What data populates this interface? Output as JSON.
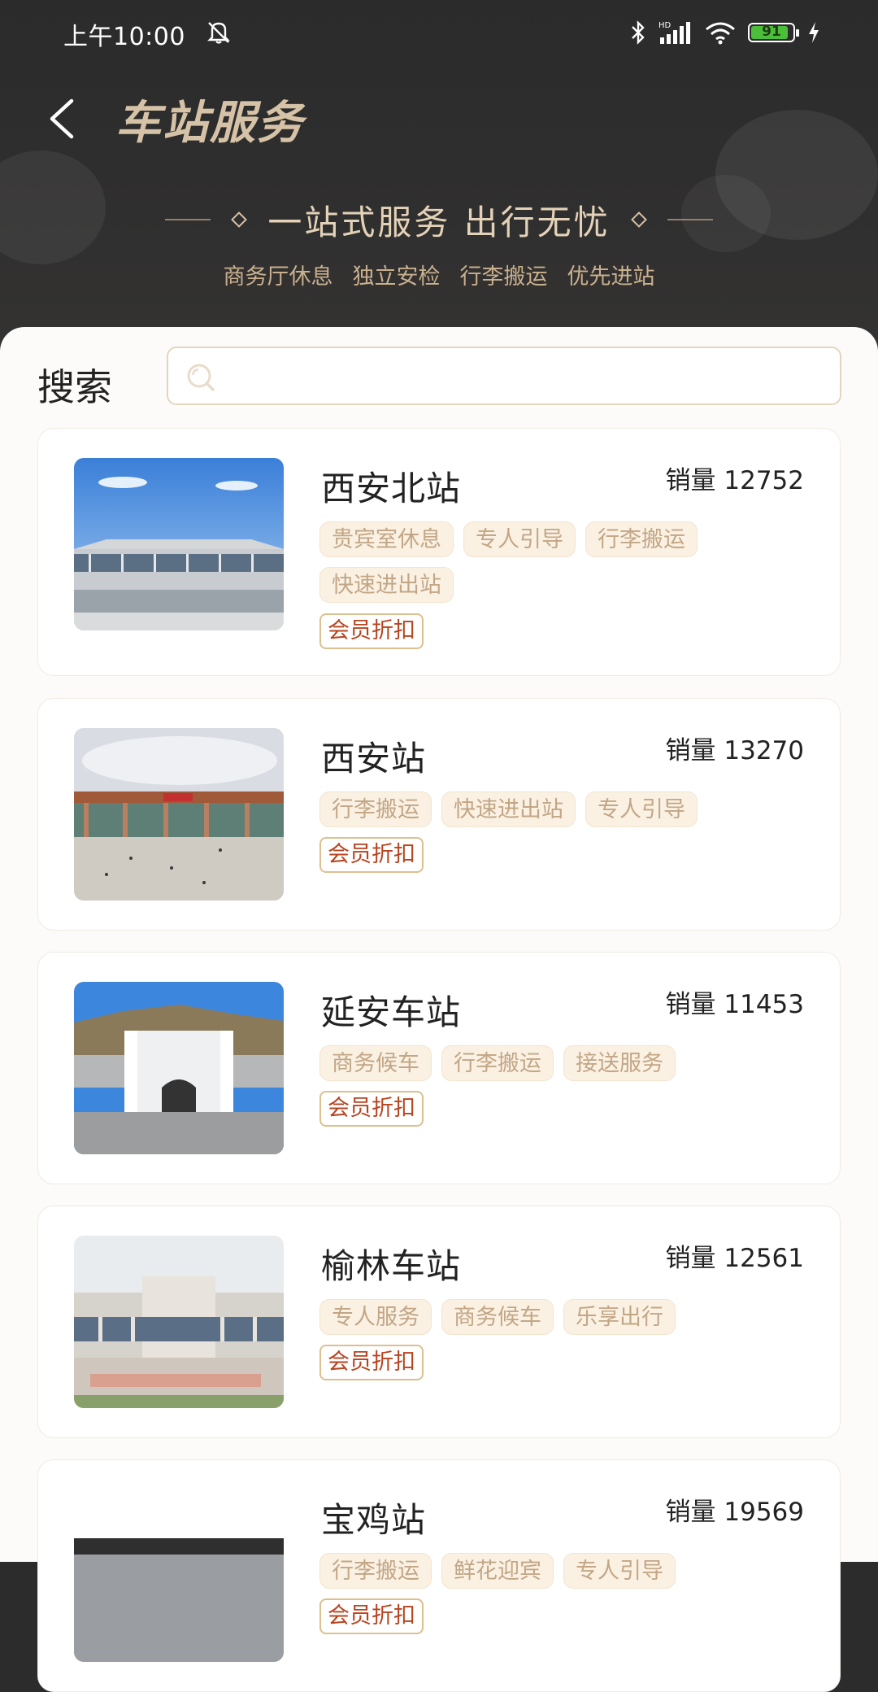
{
  "status_bar": {
    "time": "上午10:00",
    "battery": "91"
  },
  "header": {
    "title": "车站服务",
    "slogan": "一站式服务 出行无忧",
    "features": [
      "商务厅休息",
      "独立安检",
      "行李搬运",
      "优先进站"
    ]
  },
  "search": {
    "label": "搜索",
    "placeholder": ""
  },
  "stations": [
    {
      "name": "西安北站",
      "sales": "销量 12752",
      "tags": [
        "贵宾室休息",
        "专人引导",
        "行李搬运",
        "快速进出站"
      ],
      "member": "会员折扣"
    },
    {
      "name": "西安站",
      "sales": "销量 13270",
      "tags": [
        "行李搬运",
        "快速进出站",
        "专人引导"
      ],
      "member": "会员折扣"
    },
    {
      "name": "延安车站",
      "sales": "销量 11453",
      "tags": [
        "商务候车",
        "行李搬运",
        "接送服务"
      ],
      "member": "会员折扣"
    },
    {
      "name": "榆林车站",
      "sales": "销量 12561",
      "tags": [
        "专人服务",
        "商务候车",
        "乐享出行"
      ],
      "member": "会员折扣"
    },
    {
      "name": "宝鸡站",
      "sales": "销量 19569",
      "tags": [
        "行李搬运",
        "鲜花迎宾",
        "专人引导"
      ],
      "member": "会员折扣"
    }
  ],
  "colors": {
    "header_bg": "#2d2c2c",
    "title_gold": "#d6c2a6",
    "tag_bg": "#faf1e3",
    "member_red": "#b8441f"
  },
  "icons": [
    "back-arrow-icon",
    "mute-bell-icon",
    "bluetooth-icon",
    "signal-icon",
    "wifi-icon",
    "battery-icon",
    "charging-icon",
    "search-icon"
  ]
}
